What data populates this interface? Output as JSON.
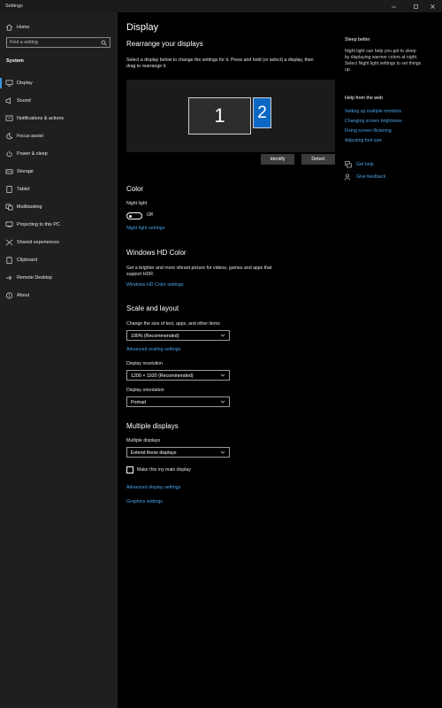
{
  "window": {
    "title": "Settings"
  },
  "sidebar": {
    "home_label": "Home",
    "search_placeholder": "Find a setting",
    "section_label": "System",
    "items": [
      {
        "label": "Display",
        "icon": "monitor-icon",
        "selected": true
      },
      {
        "label": "Sound",
        "icon": "speaker-icon"
      },
      {
        "label": "Notifications & actions",
        "icon": "notification-icon"
      },
      {
        "label": "Focus assist",
        "icon": "moon-icon"
      },
      {
        "label": "Power & sleep",
        "icon": "power-icon"
      },
      {
        "label": "Storage",
        "icon": "storage-icon"
      },
      {
        "label": "Tablet",
        "icon": "tablet-icon"
      },
      {
        "label": "Multitasking",
        "icon": "multitasking-icon"
      },
      {
        "label": "Projecting to this PC",
        "icon": "projecting-icon"
      },
      {
        "label": "Shared experiences",
        "icon": "shared-icon"
      },
      {
        "label": "Clipboard",
        "icon": "clipboard-icon"
      },
      {
        "label": "Remote Desktop",
        "icon": "remote-desktop-icon"
      },
      {
        "label": "About",
        "icon": "info-icon"
      }
    ]
  },
  "main": {
    "title": "Display",
    "rearrange": {
      "heading": "Rearrange your displays",
      "description_line1": "Select a display below to change the settings for it. Press and hold (or select) a display, then",
      "description_line2": "drag to rearrange it.",
      "monitor1": "1",
      "monitor2": "2",
      "identify_label": "Identify",
      "detect_label": "Detect"
    },
    "color": {
      "heading": "Color",
      "night_light_label": "Night light",
      "night_light_state": "Off",
      "night_light_settings_link": "Night light settings"
    },
    "hdr": {
      "heading": "Windows HD Color",
      "description_line1": "Get a brighter and more vibrant picture for videos, games and apps that",
      "description_line2": "support HDR.",
      "settings_link": "Windows HD Color settings"
    },
    "scale": {
      "heading": "Scale and layout",
      "size_label": "Change the size of text, apps, and other items",
      "size_value": "100% (Recommended)",
      "advanced_scaling_link": "Advanced scaling settings",
      "resolution_label": "Display resolution",
      "resolution_value": "1200 × 1920 (Recommended)",
      "orientation_label": "Display orientation",
      "orientation_value": "Portrait"
    },
    "multiple": {
      "heading": "Multiple displays",
      "label": "Multiple displays",
      "value": "Extend these displays",
      "main_display_label": "Make this my main display"
    },
    "advanced_display_link": "Advanced display settings",
    "graphics_link": "Graphics settings"
  },
  "right": {
    "sleep_title": "Sleep better",
    "sleep_lines": [
      "Night light can help you get to sleep",
      "by displaying warmer colors at night.",
      "Select Night light settings to set things",
      "up."
    ],
    "help_title": "Help from the web",
    "help_links": [
      "Setting up multiple monitors",
      "Changing screen brightness",
      "Fixing screen flickering",
      "Adjusting font size"
    ],
    "get_help": "Get help",
    "give_feedback": "Give feedback"
  },
  "colors": {
    "accent": "#3a96dd",
    "link": "#4aa3e8",
    "sidebar_bg": "#1f1f1f",
    "selected_monitor": "#0a68c4"
  }
}
